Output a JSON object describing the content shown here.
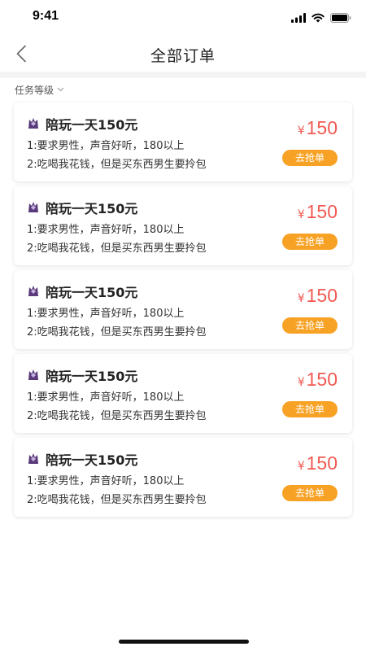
{
  "status_bar": {
    "time": "9:41",
    "icons": [
      "signal-icon",
      "wifi-icon",
      "battery-icon"
    ]
  },
  "nav": {
    "title": "全部订单",
    "back_icon": "chevron-left-icon"
  },
  "filter": {
    "label": "任务等级",
    "icon": "chevron-down-icon"
  },
  "colors": {
    "price": "#f25a54",
    "button": "#f7a224"
  },
  "orders": [
    {
      "title": "陪玩一天150元",
      "line1": "1:要求男性，声音好听，180以上",
      "line2": "2:吃喝我花钱，但是买东西男生要拎包",
      "currency": "¥",
      "price": "150",
      "button": "去抢单"
    },
    {
      "title": "陪玩一天150元",
      "line1": "1:要求男性，声音好听，180以上",
      "line2": "2:吃喝我花钱，但是买东西男生要拎包",
      "currency": "¥",
      "price": "150",
      "button": "去抢单"
    },
    {
      "title": "陪玩一天150元",
      "line1": "1:要求男性，声音好听，180以上",
      "line2": "2:吃喝我花钱，但是买东西男生要拎包",
      "currency": "¥",
      "price": "150",
      "button": "去抢单"
    },
    {
      "title": "陪玩一天150元",
      "line1": "1:要求男性，声音好听，180以上",
      "line2": "2:吃喝我花钱，但是买东西男生要拎包",
      "currency": "¥",
      "price": "150",
      "button": "去抢单"
    },
    {
      "title": "陪玩一天150元",
      "line1": "1:要求男性，声音好听，180以上",
      "line2": "2:吃喝我花钱，但是买东西男生要拎包",
      "currency": "¥",
      "price": "150",
      "button": "去抢单"
    }
  ]
}
